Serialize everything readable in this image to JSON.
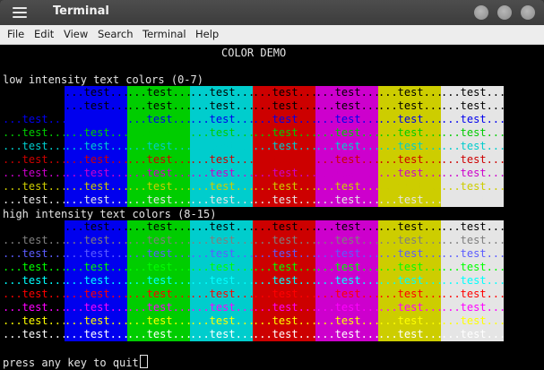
{
  "window": {
    "title": "Terminal",
    "menu": [
      "File",
      "Edit",
      "View",
      "Search",
      "Terminal",
      "Help"
    ]
  },
  "terminal": {
    "heading": "COLOR DEMO",
    "low_title": "low intensity text colors (0-7)",
    "high_title": "high intensity text colors (8-15)",
    "cell_text": "...test...",
    "prompt": "press any key to quit",
    "low_fg": [
      "#000000",
      "#0000ee",
      "#00cd00",
      "#00cdcd",
      "#cd0000",
      "#cd00cd",
      "#cdcd00",
      "#e5e5e5"
    ],
    "high_fg": [
      "#7f7f7f",
      "#5c5cff",
      "#00ff00",
      "#00ffff",
      "#ff0000",
      "#ff00ff",
      "#ffff00",
      "#ffffff"
    ],
    "low_bg": [
      "#000000",
      "#0000ee",
      "#00cd00",
      "#00cdcd",
      "#cd0000",
      "#cd00cd",
      "#cdcd00",
      "#e5e5e5"
    ],
    "high_bg": [
      "#000000",
      "#0000ee",
      "#00cd00",
      "#00cdcd",
      "#cd0000",
      "#cd00cd",
      "#cdcd00",
      "#e5e5e5"
    ]
  },
  "colors": {
    "titlebar": "#404040",
    "menubar": "#ededed",
    "terminal_bg": "#000000",
    "terminal_fg": "#e5e5e5"
  }
}
